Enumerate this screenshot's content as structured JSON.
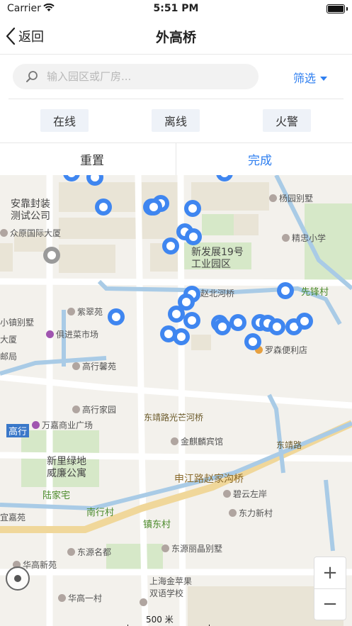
{
  "status_bar": {
    "carrier": "Carrier",
    "time": "5:51 PM"
  },
  "nav": {
    "back_label": "返回",
    "title": "外高桥"
  },
  "search": {
    "placeholder": "输入园区或厂房..."
  },
  "filter": {
    "label": "筛选"
  },
  "status_filters": [
    {
      "label": "在线"
    },
    {
      "label": "离线"
    },
    {
      "label": "火警"
    }
  ],
  "actions": {
    "reset_label": "重置",
    "done_label": "完成"
  },
  "colors": {
    "accent": "#2f7ff0",
    "marker": "#3f86f0",
    "offline_marker": "#9a9a9a"
  },
  "map": {
    "labels": {
      "anjing": "安靠封装\n测试公司",
      "zhongyuan": "众原国际大厦",
      "yangyuan": "杨园别墅",
      "jingzhong": "精忠小学",
      "xinfazhan": "新发展19号\n工业园区",
      "zhaobeihe": "赵北河桥",
      "xianfeng": "先锋村",
      "xiaozhen": "小镇别墅",
      "daxia": "大厦",
      "youju": "邮局",
      "zicuiyuan": "紫翠苑",
      "jujin": "俱进菜市场",
      "luosen": "罗森便利店",
      "gaohangxinyuan": "高行馨苑",
      "gaohangjiayuan": "高行家园",
      "dongjing": "东靖路光芒河桥",
      "wanjia": "万嘉商业广场",
      "gaohang": "高行",
      "jinqilin": "金麒麟宾馆",
      "dongjinglu": "东靖路",
      "xinli": "新里绿地\n威廉公寓",
      "shenjiang": "申江路赵家沟桥",
      "lujiazhai": "陆家宅",
      "biyun": "碧云左岸",
      "yijiayuan": "宜嘉苑",
      "nanhangcun": "南行村",
      "dongli": "东力新村",
      "zhendong": "镇东村",
      "dongyuanmingdu": "东源名都",
      "dongyuanlijing": "东源丽晶别墅",
      "huagaoxinyuan": "华高新苑",
      "shanghaijin": "上海金苹果\n双语学校",
      "huagaoyicun": "华高一村"
    },
    "scale": "500 米",
    "zoom_in": "+",
    "zoom_out": "−",
    "markers_online": 31,
    "markers_offline": 1
  }
}
